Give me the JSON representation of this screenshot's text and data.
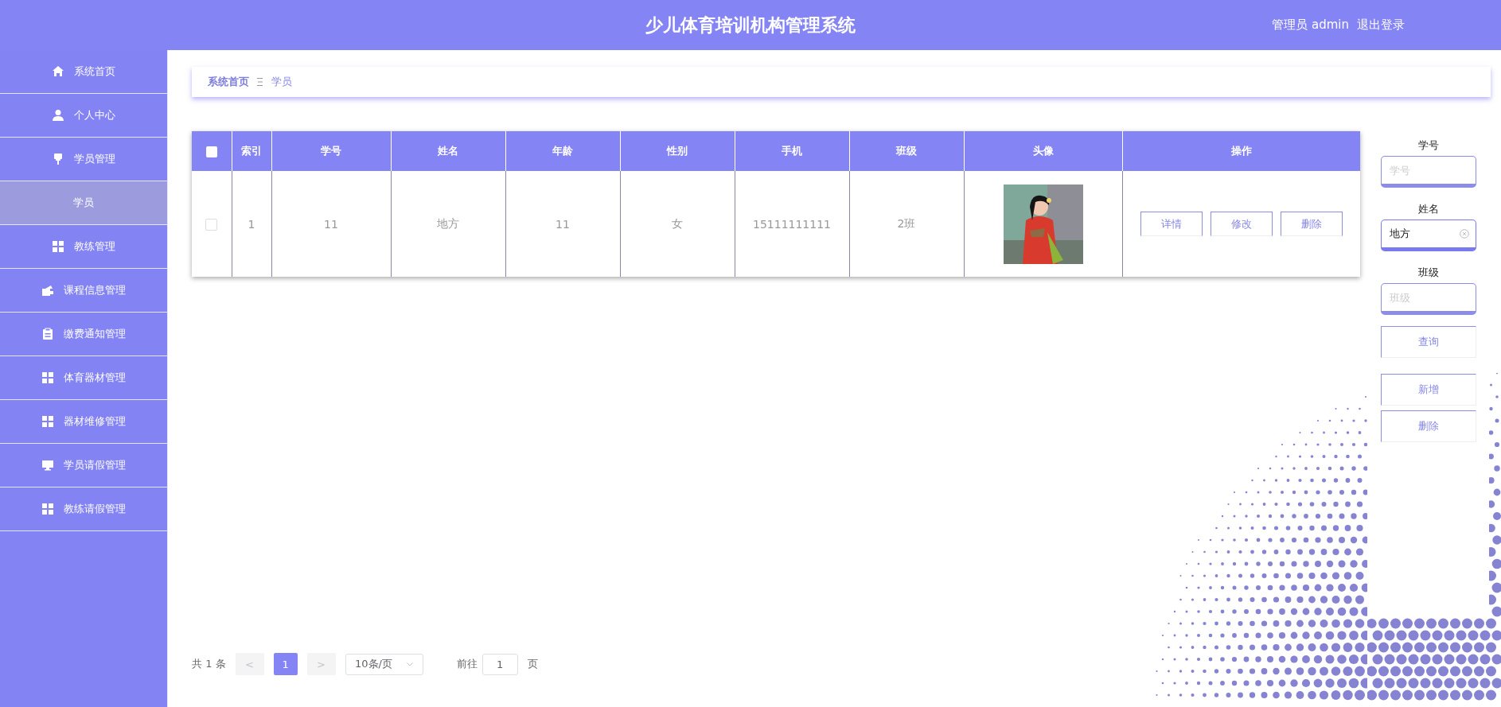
{
  "header": {
    "title": "少儿体育培训机构管理系统",
    "user": "管理员 admin",
    "logout": "退出登录"
  },
  "sidebar": {
    "items": [
      {
        "label": "系统首页",
        "selected": false
      },
      {
        "label": "个人中心",
        "selected": false
      },
      {
        "label": "学员管理",
        "selected": false,
        "children": [
          {
            "label": "学员",
            "selected": true
          }
        ]
      },
      {
        "label": "教练管理",
        "selected": false
      },
      {
        "label": "课程信息管理",
        "selected": false
      },
      {
        "label": "缴费通知管理",
        "selected": false
      },
      {
        "label": "体育器材管理",
        "selected": false
      },
      {
        "label": "器材维修管理",
        "selected": false
      },
      {
        "label": "学员请假管理",
        "selected": false
      },
      {
        "label": "教练请假管理",
        "selected": false
      }
    ]
  },
  "breadcrumb": [
    "系统首页",
    "学员"
  ],
  "table": {
    "all_checked": false,
    "columns": [
      "索引",
      "学号",
      "姓名",
      "年龄",
      "性别",
      "手机",
      "班级",
      "头像",
      "操作"
    ],
    "rows": [
      {
        "checked": false,
        "cells": [
          "1",
          "11",
          "地方",
          "11",
          "女",
          "15111111111",
          "2班"
        ],
        "actions": [
          "详情",
          "修改",
          "删除"
        ]
      }
    ]
  },
  "search": {
    "fields": [
      {
        "label": "学号",
        "placeholder": "学号",
        "focused": false
      },
      {
        "label": "姓名",
        "value": "地方",
        "clearable": true,
        "focused": true
      },
      {
        "label": "班级",
        "placeholder": "班级",
        "focused": false
      }
    ],
    "query_button": "查询",
    "buttons": [
      "新增",
      "删除"
    ]
  },
  "pagination": {
    "total": "共 1 条",
    "prev": {
      "label": "<",
      "disabled": true
    },
    "pages": [
      {
        "label": "1",
        "selected": true
      }
    ],
    "next": {
      "label": ">",
      "disabled": true
    },
    "page_size": "10条/页",
    "goto_label": "前往",
    "goto_value": "1",
    "goto_unit": "页"
  }
}
